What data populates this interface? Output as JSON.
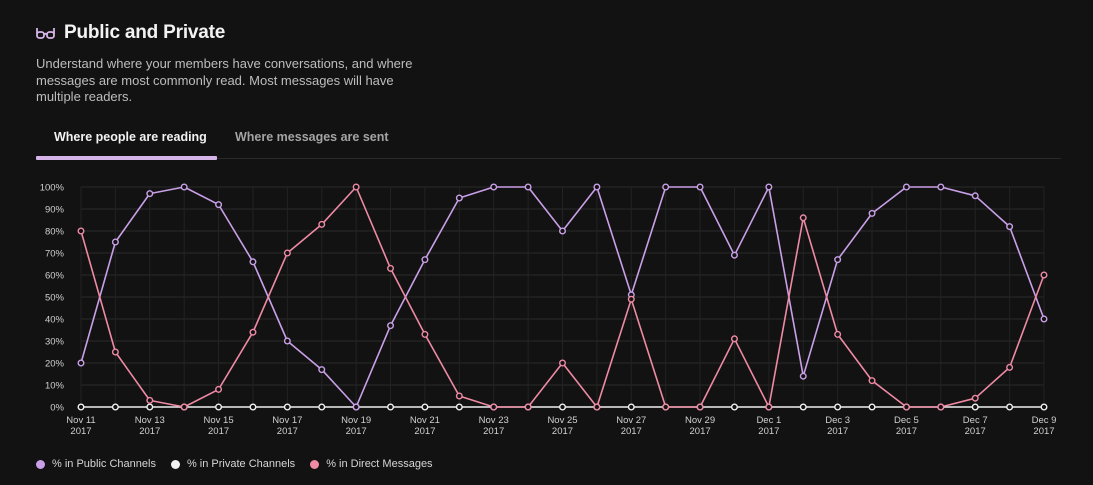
{
  "header": {
    "title": "Public and Private",
    "icon": "glasses-icon",
    "description": "Understand where your members have conversations, and where messages are most commonly read. Most messages will have multiple readers."
  },
  "tabs": [
    {
      "label": "Where people are reading",
      "active": true
    },
    {
      "label": "Where messages are sent",
      "active": false
    }
  ],
  "colors": {
    "background": "#121212",
    "public": "#c9a0e8",
    "private": "#f0f0f0",
    "direct": "#ee8aa4",
    "tab_underline": "#d6b4e8"
  },
  "chart_data": {
    "type": "line",
    "x": [
      "Nov 11 2017",
      "Nov 12 2017",
      "Nov 13 2017",
      "Nov 14 2017",
      "Nov 15 2017",
      "Nov 16 2017",
      "Nov 17 2017",
      "Nov 18 2017",
      "Nov 19 2017",
      "Nov 20 2017",
      "Nov 21 2017",
      "Nov 22 2017",
      "Nov 23 2017",
      "Nov 24 2017",
      "Nov 25 2017",
      "Nov 26 2017",
      "Nov 27 2017",
      "Nov 28 2017",
      "Nov 29 2017",
      "Nov 30 2017",
      "Dec 1 2017",
      "Dec 2 2017",
      "Dec 3 2017",
      "Dec 4 2017",
      "Dec 5 2017",
      "Dec 6 2017",
      "Dec 7 2017",
      "Dec 8 2017",
      "Dec 9 2017"
    ],
    "x_ticks": [
      {
        "month": "Nov 11",
        "year": "2017",
        "index": 0
      },
      {
        "month": "Nov 13",
        "year": "2017",
        "index": 2
      },
      {
        "month": "Nov 15",
        "year": "2017",
        "index": 4
      },
      {
        "month": "Nov 17",
        "year": "2017",
        "index": 6
      },
      {
        "month": "Nov 19",
        "year": "2017",
        "index": 8
      },
      {
        "month": "Nov 21",
        "year": "2017",
        "index": 10
      },
      {
        "month": "Nov 23",
        "year": "2017",
        "index": 12
      },
      {
        "month": "Nov 25",
        "year": "2017",
        "index": 14
      },
      {
        "month": "Nov 27",
        "year": "2017",
        "index": 16
      },
      {
        "month": "Nov 29",
        "year": "2017",
        "index": 18
      },
      {
        "month": "Dec 1",
        "year": "2017",
        "index": 20
      },
      {
        "month": "Dec 3",
        "year": "2017",
        "index": 22
      },
      {
        "month": "Dec 5",
        "year": "2017",
        "index": 24
      },
      {
        "month": "Dec 7",
        "year": "2017",
        "index": 26
      },
      {
        "month": "Dec 9",
        "year": "2017",
        "index": 28
      }
    ],
    "y_ticks": [
      "0%",
      "10%",
      "20%",
      "30%",
      "40%",
      "50%",
      "60%",
      "70%",
      "80%",
      "90%",
      "100%"
    ],
    "ylim": [
      0,
      100
    ],
    "grid": true,
    "legend_position": "bottom-left",
    "series": [
      {
        "name": "% in Public Channels",
        "color": "#c9a0e8",
        "values": [
          20,
          75,
          97,
          100,
          92,
          66,
          30,
          17,
          0,
          37,
          67,
          95,
          100,
          100,
          80,
          100,
          51,
          100,
          100,
          69,
          100,
          14,
          67,
          88,
          100,
          100,
          96,
          82,
          40
        ]
      },
      {
        "name": "% in Private Channels",
        "color": "#f0f0f0",
        "values": [
          0,
          0,
          0,
          0,
          0,
          0,
          0,
          0,
          0,
          0,
          0,
          0,
          0,
          0,
          0,
          0,
          0,
          0,
          0,
          0,
          0,
          0,
          0,
          0,
          0,
          0,
          0,
          0,
          0
        ]
      },
      {
        "name": "% in Direct Messages",
        "color": "#ee8aa4",
        "values": [
          80,
          25,
          3,
          0,
          8,
          34,
          70,
          83,
          100,
          63,
          33,
          5,
          0,
          0,
          20,
          0,
          49,
          0,
          0,
          31,
          0,
          86,
          33,
          12,
          0,
          0,
          4,
          18,
          60
        ]
      }
    ]
  }
}
